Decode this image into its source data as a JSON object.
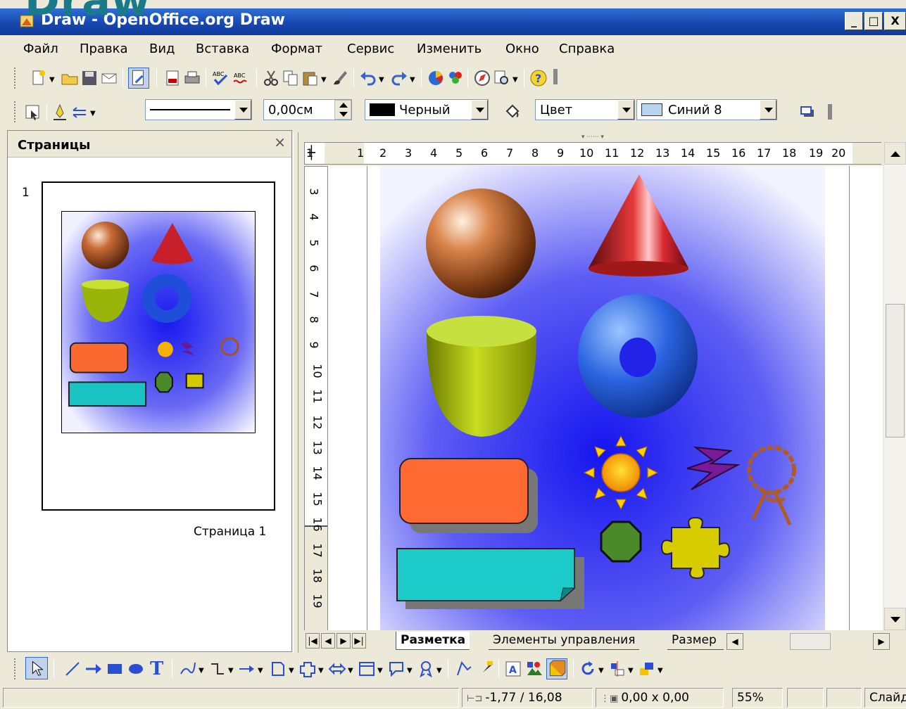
{
  "overlay_heading": "Draw",
  "window": {
    "title": "Draw - OpenOffice.org Draw",
    "minimize": "_",
    "maximize": "□",
    "close": "X"
  },
  "menu": [
    "Файл",
    "Правка",
    "Вид",
    "Вставка",
    "Формат",
    "Сервис",
    "Изменить",
    "Окно",
    "Справка"
  ],
  "line_toolbar": {
    "line_width": "0,00см",
    "line_color": "Черный",
    "area_style": "Цвет",
    "area_color": "Синий 8"
  },
  "pages_panel": {
    "title": "Страницы",
    "close": "×",
    "page_number": "1",
    "page_caption": "Страница 1"
  },
  "hruler_labels": [
    "1",
    "1",
    "2",
    "3",
    "4",
    "5",
    "6",
    "7",
    "8",
    "9",
    "10",
    "11",
    "12",
    "13",
    "14",
    "15",
    "16",
    "17",
    "18",
    "19",
    "20"
  ],
  "vruler_labels": [
    "3",
    "4",
    "5",
    "6",
    "7",
    "8",
    "9",
    "10",
    "11",
    "12",
    "13",
    "14",
    "15",
    "16",
    "17",
    "18",
    "19"
  ],
  "tabs": [
    "Разметка",
    "Элементы управления",
    "Размер"
  ],
  "status": {
    "position": "-1,77 / 16,08",
    "size": "0,00 x 0,00",
    "zoom": "55%",
    "slide": "Слайд"
  },
  "colors": {
    "title_bar": "#1747b0",
    "heading_text": "#1a7a8a",
    "canvas_blue": "#2030e8"
  }
}
